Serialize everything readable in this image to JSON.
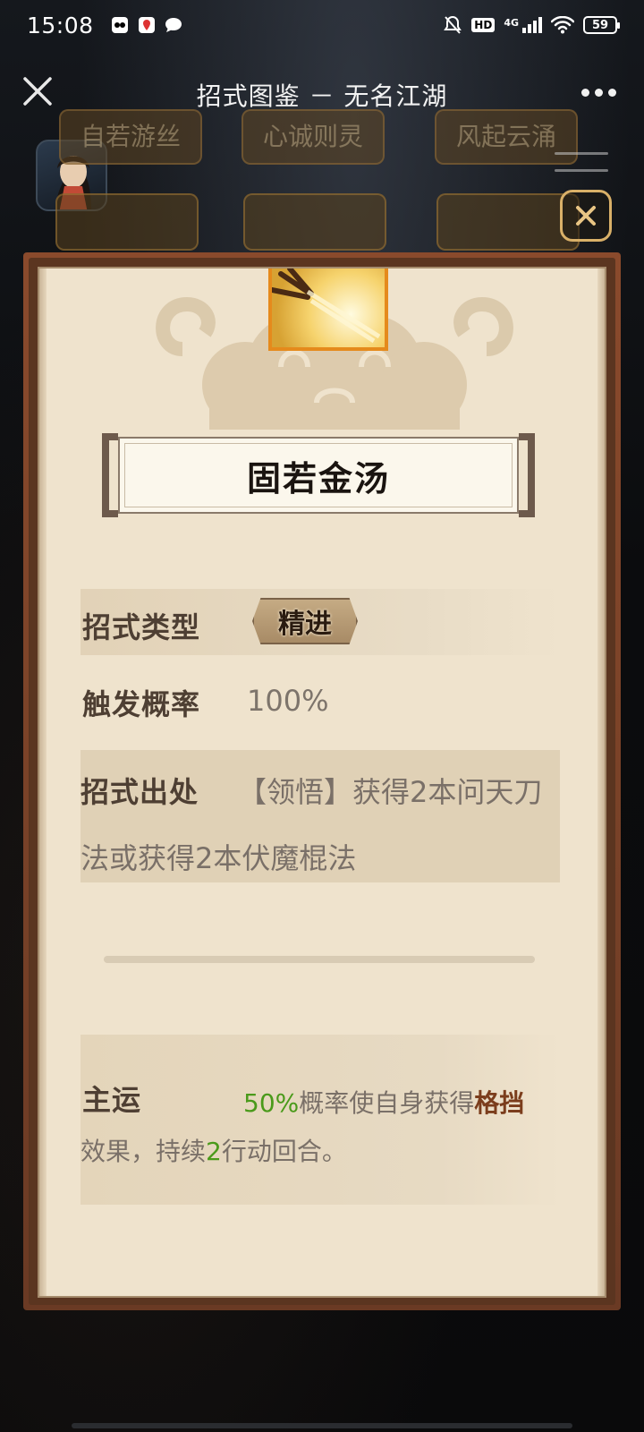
{
  "status_bar": {
    "time": "15:08",
    "hd": "HD",
    "network": "4G",
    "battery": "59"
  },
  "header": {
    "title": "招式图鉴 － 无名江湖"
  },
  "background_ui": {
    "cards": [
      "自若游丝",
      "心诚则灵",
      "风起云涌"
    ]
  },
  "skill": {
    "name": "固若金汤",
    "type_label": "招式类型",
    "type_value": "精进",
    "rate_label": "触发概率",
    "rate_value": "100%",
    "source_label": "招式出处",
    "source_value": "【领悟】获得2本问天刀法或获得2本伏魔棍法",
    "effect_label": "主运",
    "effect_percent": "50%",
    "effect_text_1": "概率使自身获得",
    "effect_keyword": "格挡",
    "effect_text_2": "效果，持续",
    "effect_turns": "2",
    "effect_text_3": "行动回合。"
  },
  "colors": {
    "accent_green": "#4a9a1a",
    "keyword_brown": "#7b3d1c",
    "paper": "#efe3cd",
    "frame": "#7a4228",
    "close_border": "#d9b068"
  },
  "icons": [
    "close-icon",
    "more-icon",
    "menu-icon",
    "dialog-close-icon",
    "wifi-icon",
    "signal-icon",
    "mute-bell-icon",
    "chat-icon"
  ]
}
